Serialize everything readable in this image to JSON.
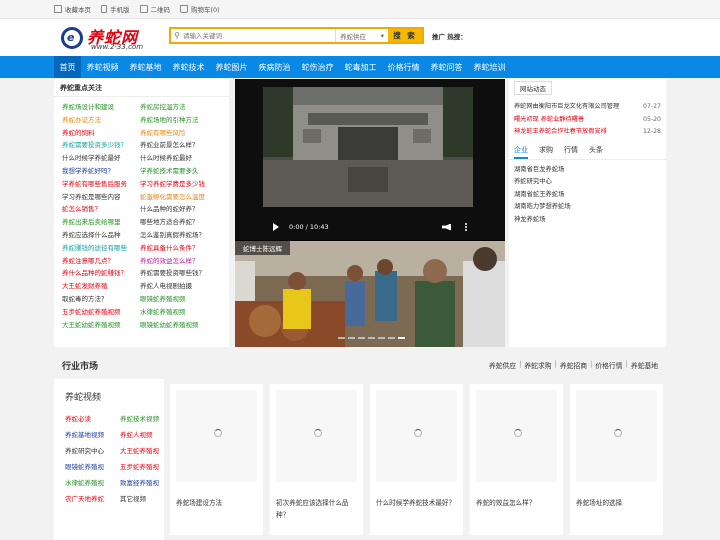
{
  "topbar": {
    "links": [
      "收藏本页",
      "手机版",
      "二维码",
      "购物车(0)"
    ]
  },
  "header": {
    "logo_cn": "养蛇网",
    "logo_url": "www.2-33.com",
    "search_placeholder": "请输入关键词",
    "search_category": "养蛇供应",
    "search_button": "搜 索",
    "hot_label": "推广 热搜："
  },
  "nav": {
    "items": [
      "首页",
      "养蛇视频",
      "养蛇基地",
      "养蛇技术",
      "养蛇图片",
      "疾病防治",
      "蛇伤治疗",
      "蛇毒加工",
      "价格行情",
      "养蛇问答",
      "养蛇培训"
    ],
    "active_index": 0
  },
  "focus": {
    "title": "养蛇重点关注",
    "items": [
      {
        "text": "养蛇场设计和建设",
        "color": "#229122"
      },
      {
        "text": "养蛇房控温方法",
        "color": "#229122"
      },
      {
        "text": "养蛇办证方法",
        "color": "#e8860c"
      },
      {
        "text": "养蛇场地的引种方法",
        "color": "#229122"
      },
      {
        "text": "养蛇的饲料",
        "color": "#e3000f"
      },
      {
        "text": "养蛇有哪些风险",
        "color": "#e8860c"
      },
      {
        "text": "养蛇需要投资多少钱？",
        "color": "#11a2a2"
      },
      {
        "text": "养蛇业前景怎么样？",
        "color": "#333333"
      },
      {
        "text": "什么时候学养蛇最好",
        "color": "#333333"
      },
      {
        "text": "什么时候养蛇最好",
        "color": "#333333"
      },
      {
        "text": "我想学养蛇好吗？",
        "color": "#1a3da8"
      },
      {
        "text": "学养蛇技术需要多久",
        "color": "#229122"
      },
      {
        "text": "学养蛇有哪些售后服务",
        "color": "#e3000f"
      },
      {
        "text": "学习养蛇学费是多少钱",
        "color": "#e3000f"
      },
      {
        "text": "学习养蛇是哪些内容",
        "color": "#333333"
      },
      {
        "text": "蛇蛋孵化需要怎么温度",
        "color": "#e8860c"
      },
      {
        "text": "蛇怎么销售？",
        "color": "#e3000f"
      },
      {
        "text": "什么品种的蛇好养？",
        "color": "#333333"
      },
      {
        "text": "养蛇出来后卖给哪里",
        "color": "#229122"
      },
      {
        "text": "哪些地方适合养蛇？",
        "color": "#333333"
      },
      {
        "text": "养蛇应选择什么品种",
        "color": "#333333"
      },
      {
        "text": "怎么鉴别真假养蛇场？",
        "color": "#333333"
      },
      {
        "text": "养蛇赚钱的途径有哪些",
        "color": "#11a2a2"
      },
      {
        "text": "养蛇具备什么条件？",
        "color": "#e3000f"
      },
      {
        "text": "养蛇注意哪几点？",
        "color": "#e3000f"
      },
      {
        "text": "养蛇的效益怎么样？",
        "color": "#c01f9b"
      },
      {
        "text": "养什么品种的蛇赚钱？",
        "color": "#e3000f"
      },
      {
        "text": "养蛇需要投资哪些钱？",
        "color": "#333333"
      },
      {
        "text": "大王蛇发财养殖",
        "color": "#e3000f"
      },
      {
        "text": "养蛇人电视剧拍摄",
        "color": "#333333"
      },
      {
        "text": "取蛇毒的方法？",
        "color": "#333333"
      },
      {
        "text": "眼镜蛇养殖视频",
        "color": "#229122"
      },
      {
        "text": "五步蛇幼蛇养殖视频",
        "color": "#e3000f"
      },
      {
        "text": "水律蛇养殖视频",
        "color": "#229122"
      },
      {
        "text": "大王蛇幼蛇养殖视频",
        "color": "#229122"
      },
      {
        "text": "眼镜蛇幼蛇养殖视频",
        "color": "#229122"
      }
    ]
  },
  "video": {
    "time": "0:00 / 10:43",
    "slide_caption": "蛇博士陈远辉"
  },
  "site_news": {
    "title": "网站动态",
    "items": [
      {
        "text": "养蛇网由衡阳市巨龙文化有限公司管理",
        "date": "07-27",
        "color": "#333333"
      },
      {
        "text": "曙光初现 养蛇业静待曙善",
        "date": "05-20",
        "color": "#e3000f"
      },
      {
        "text": "神龙蛇王养蛇合作社春节放假安排",
        "date": "12-28",
        "color": "#e3000f"
      }
    ]
  },
  "right_tabs": {
    "tabs": [
      "企业",
      "求购",
      "行情",
      "头条"
    ],
    "active_index": 0,
    "items": [
      "湖南省巨龙养蛇场",
      "养蛇研究中心",
      "湖南省蛇王养蛇场",
      "湖南皓力梦想养蛇场",
      "神龙养蛇场"
    ]
  },
  "market": {
    "title": "行业市场",
    "links": [
      "养蛇供应",
      "养蛇求购",
      "养蛇招商",
      "价格行情",
      "养蛇基地"
    ]
  },
  "video_cats": {
    "title": "养蛇视频",
    "items": [
      {
        "text": "养蛇必读",
        "color": "#e3000f"
      },
      {
        "text": "养蛇技术视频",
        "color": "#229122"
      },
      {
        "text": "养蛇基地视频",
        "color": "#1a3da8"
      },
      {
        "text": "养蛇人视频",
        "color": "#e3000f"
      },
      {
        "text": "养蛇研究中心",
        "color": "#333333"
      },
      {
        "text": "大王蛇养殖视",
        "color": "#e3000f"
      },
      {
        "text": "眼镜蛇养殖视",
        "color": "#1a3da8"
      },
      {
        "text": "五步蛇养殖视",
        "color": "#e3000f"
      },
      {
        "text": "水律蛇养殖视",
        "color": "#229122"
      },
      {
        "text": "致富经养殖视",
        "color": "#1a3da8"
      },
      {
        "text": "农广天地养蛇",
        "color": "#e3000f"
      },
      {
        "text": "其它视频",
        "color": "#333333"
      }
    ]
  },
  "cards": [
    {
      "title": "养蛇场建设方法"
    },
    {
      "title": "初次养蛇应该选择什么品种？"
    },
    {
      "title": "什么时候学养蛇技术最好？"
    },
    {
      "title": "养蛇的效益怎么样？"
    },
    {
      "title": "养蛇场址的选择"
    }
  ]
}
